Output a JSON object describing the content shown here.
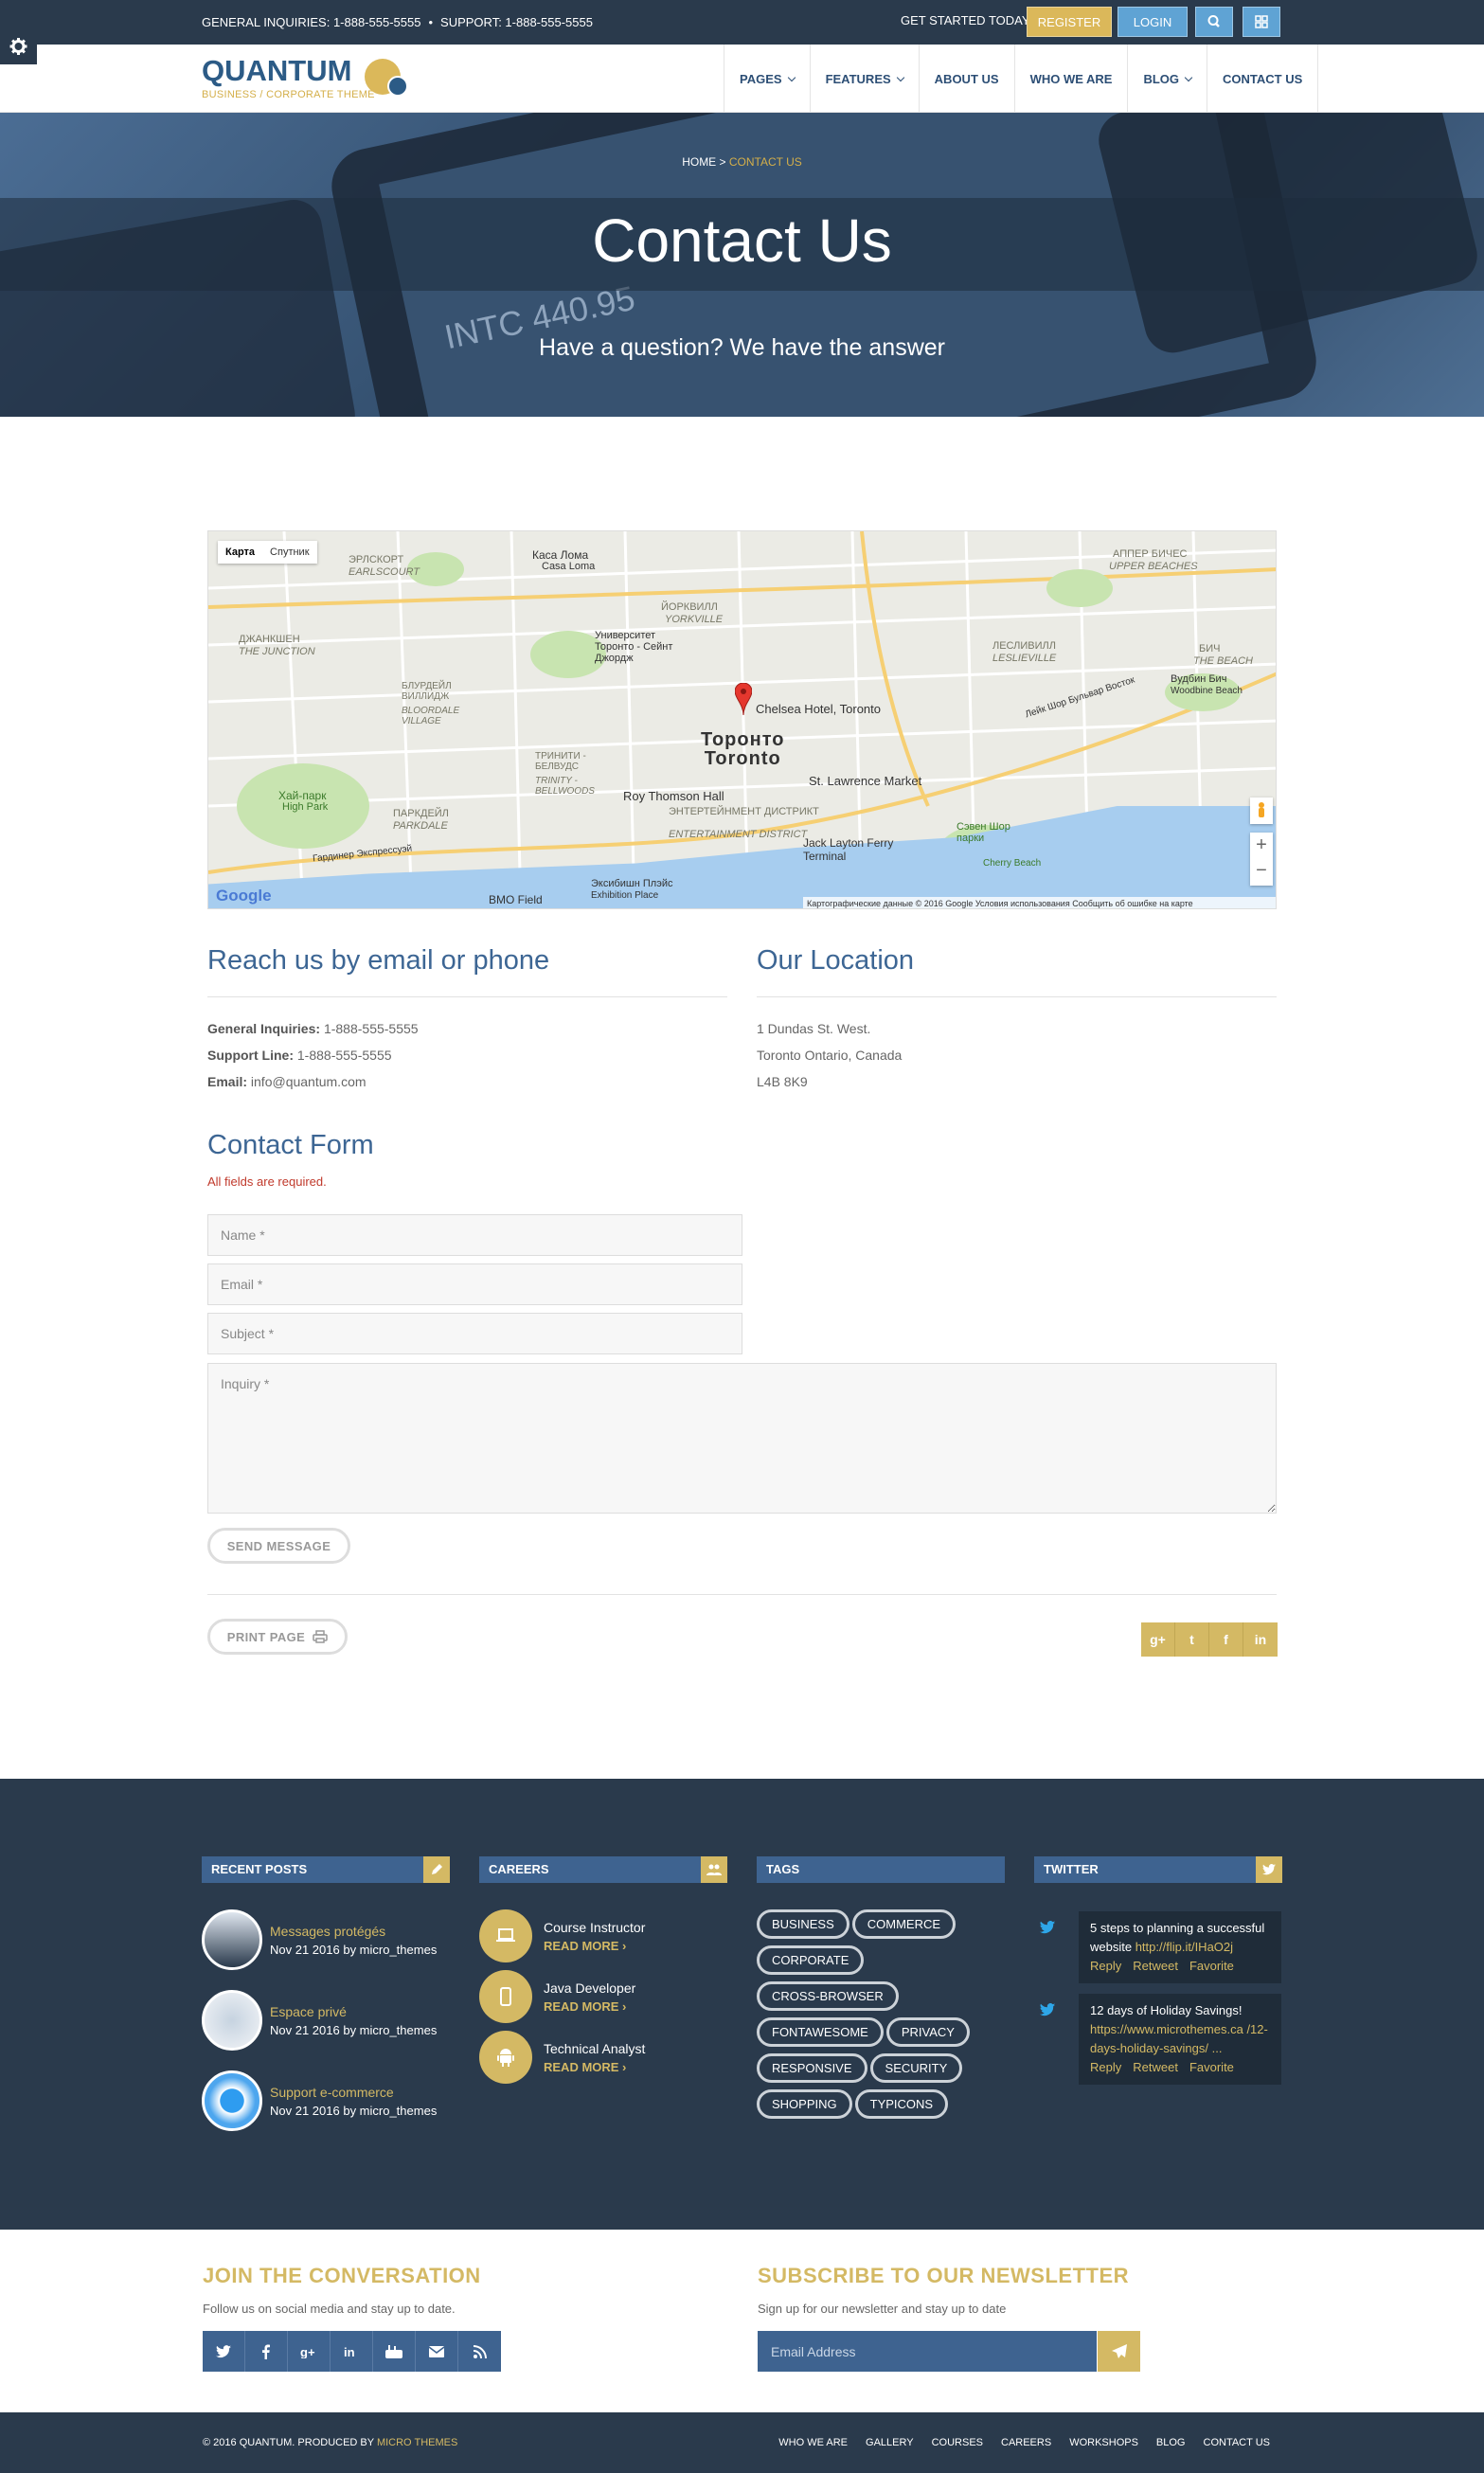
{
  "topbar": {
    "general": "GENERAL INQUIRIES: 1-888-555-5555",
    "separator": "•",
    "support": "SUPPORT: 1-888-555-5555",
    "get_started": "GET STARTED TODAY",
    "register": "REGISTER",
    "login": "LOGIN"
  },
  "logo": {
    "name": "QUANTUM",
    "tagline": "BUSINESS / CORPORATE THEME"
  },
  "nav": [
    {
      "label": "PAGES",
      "dropdown": true
    },
    {
      "label": "FEATURES",
      "dropdown": true
    },
    {
      "label": "ABOUT US",
      "dropdown": false
    },
    {
      "label": "WHO WE ARE",
      "dropdown": false
    },
    {
      "label": "BLOG",
      "dropdown": true
    },
    {
      "label": "CONTACT US",
      "dropdown": false
    }
  ],
  "hero": {
    "crumb_home": "HOME",
    "crumb_sep": ">",
    "crumb_current": "CONTACT US",
    "title": "Contact Us",
    "subtitle": "Have a question? We have the answer"
  },
  "map": {
    "tab_map": "Карта",
    "tab_satellite": "Спутник",
    "city_ru": "Торонто",
    "city_en": "Toronto",
    "labels": [
      "Каса Лома",
      "Casa Loma",
      "ЭРЛСКОРТ",
      "EARLSCOURT",
      "ДЖАНКШЕН",
      "THE JUNCTION",
      "Университет Торонто - Сейнт Джордж",
      "Chelsea Hotel, Toronto",
      "St. Lawrence Market",
      "Roy Thomson Hall",
      "ЭНТЕРТЕЙНМЕНТ ДИСТРИКТ",
      "ENTERTAINMENT DISTRICT",
      "Jack Layton Ferry Terminal",
      "BMO Field",
      "Эксибишн Плэйс",
      "Exhibition Place",
      "Хай-парк",
      "High Park",
      "ТРИНИТИ - БЕЛВУДС",
      "TRINITY - BELLWOODS",
      "ПАРКДЕЙЛ",
      "PARKDALE",
      "БЛУРДЕЙЛ ВИЛЛИДЖ",
      "BLOORDALE VILLAGE",
      "ЙОРКВИЛЛ",
      "YORKVILLE",
      "АППЕР БИЧЕС",
      "UPPER BEACHES",
      "ЛЕСЛИВИЛЛ",
      "LESLIEVILLE",
      "БИЧ",
      "THE BEACH",
      "Вудбин Бич",
      "Woodbine Beach",
      "Гардинер Экспрессуэй",
      "Лейк Шор Бульвар Восток",
      "Сэвен Шор парки",
      "Cherry Beach"
    ],
    "google": "Google",
    "attribution": "Картографические данные © 2016 Google   Условия использования   Сообщить об ошибке на карте"
  },
  "contact": {
    "reach_title": "Reach us by email or phone",
    "general_label": "General Inquiries:",
    "general_value": "1-888-555-5555",
    "support_label": "Support Line:",
    "support_value": "1-888-555-5555",
    "email_label": "Email:",
    "email_value": "info@quantum.com",
    "location_title": "Our Location",
    "address1": "1 Dundas St. West.",
    "address2": "Toronto Ontario, Canada",
    "address3": "L4B 8K9"
  },
  "form": {
    "title": "Contact Form",
    "required": "All fields are required.",
    "name_ph": "Name *",
    "email_ph": "Email *",
    "subject_ph": "Subject *",
    "inquiry_ph": "Inquiry *",
    "send": "SEND MESSAGE",
    "print": "PRINT PAGE"
  },
  "share": [
    "g+",
    "t",
    "f",
    "in"
  ],
  "footer": {
    "recent_title": "RECENT POSTS",
    "posts": [
      {
        "title": "Messages protégés",
        "meta": "Nov 21 2016 by micro_themes"
      },
      {
        "title": "Espace privé",
        "meta": "Nov 21 2016 by micro_themes"
      },
      {
        "title": "Support e-commerce",
        "meta": "Nov 21 2016 by micro_themes"
      }
    ],
    "careers_title": "CAREERS",
    "careers": [
      {
        "title": "Course Instructor",
        "more": "READ MORE ›"
      },
      {
        "title": "Java Developer",
        "more": "READ MORE ›"
      },
      {
        "title": "Technical Analyst",
        "more": "READ MORE ›"
      }
    ],
    "tags_title": "TAGS",
    "tags": [
      "BUSINESS",
      "COMMERCE",
      "CORPORATE",
      "CROSS-BROWSER",
      "FONTAWESOME",
      "PRIVACY",
      "RESPONSIVE",
      "SECURITY",
      "SHOPPING",
      "TYPICONS"
    ],
    "twitter_title": "TWITTER",
    "tweets": [
      {
        "text": "5 steps to planning a successful website",
        "link": "http://flip.it/IHaO2j"
      },
      {
        "text": "12 days of Holiday Savings!",
        "link": "https://www.microthemes.ca /12-days-holiday-savings/ ..."
      }
    ],
    "tweet_reply": "Reply",
    "tweet_retweet": "Retweet",
    "tweet_favorite": "Favorite"
  },
  "lower": {
    "join_title": "JOIN THE CONVERSATION",
    "join_text": "Follow us on social media and stay up to date.",
    "newsletter_title": "SUBSCRIBE TO OUR NEWSLETTER",
    "newsletter_text": "Sign up for our newsletter and stay up to date",
    "email_ph": "Email Address"
  },
  "bottom": {
    "copyright": "© 2016 QUANTUM. PRODUCED BY",
    "producer": "MICRO THEMES",
    "links": [
      "WHO WE ARE",
      "GALLERY",
      "COURSES",
      "CAREERS",
      "WORKSHOPS",
      "BLOG",
      "CONTACT US"
    ]
  },
  "colors": {
    "accent": "#d4b964",
    "primary": "#3e6390",
    "dark": "#2a3a4c",
    "error": "#c0392b"
  }
}
